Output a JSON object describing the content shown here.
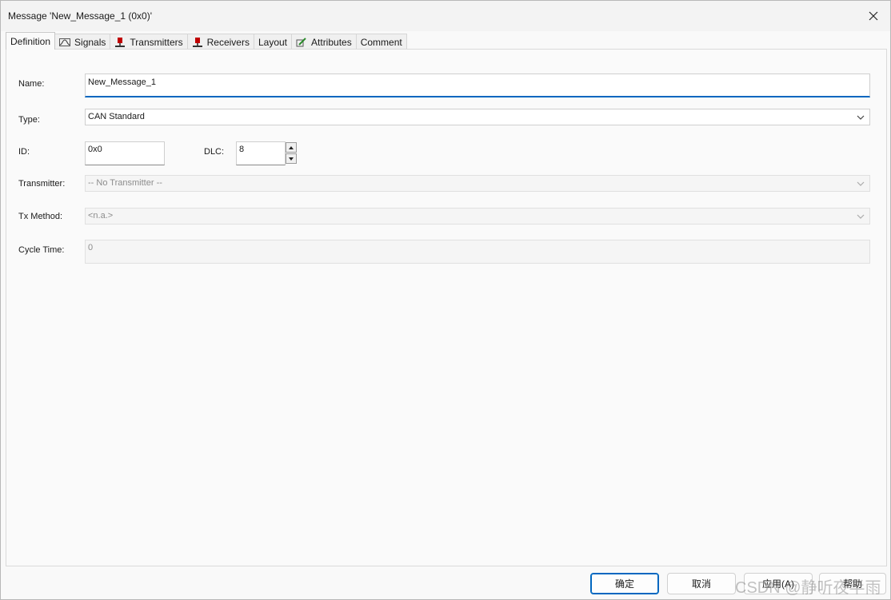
{
  "window": {
    "title": "Message 'New_Message_1 (0x0)'",
    "close_glyph": "✕"
  },
  "tabs": [
    {
      "label": "Definition",
      "icon": ""
    },
    {
      "label": "Signals",
      "icon": "signal-icon"
    },
    {
      "label": "Transmitters",
      "icon": "transmitter-icon"
    },
    {
      "label": "Receivers",
      "icon": "receiver-icon"
    },
    {
      "label": "Layout",
      "icon": ""
    },
    {
      "label": "Attributes",
      "icon": "attributes-icon"
    },
    {
      "label": "Comment",
      "icon": ""
    }
  ],
  "form": {
    "name_label": "Name:",
    "name_value": "New_Message_1",
    "type_label": "Type:",
    "type_value": "CAN Standard",
    "id_label": "ID:",
    "id_value": "0x0",
    "dlc_label": "DLC:",
    "dlc_value": "8",
    "transmitter_label": "Transmitter:",
    "transmitter_value": "-- No Transmitter --",
    "txmethod_label": "Tx Method:",
    "txmethod_value": "<n.a.>",
    "cycletime_label": "Cycle Time:",
    "cycletime_value": "0"
  },
  "buttons": {
    "ok": "确定",
    "cancel": "取消",
    "apply": "应用(A)",
    "help": "帮助"
  },
  "watermark": "CSDN @静听夜半雨",
  "colors": {
    "accent": "#0067c0",
    "tab_icon_red": "#c00000"
  }
}
